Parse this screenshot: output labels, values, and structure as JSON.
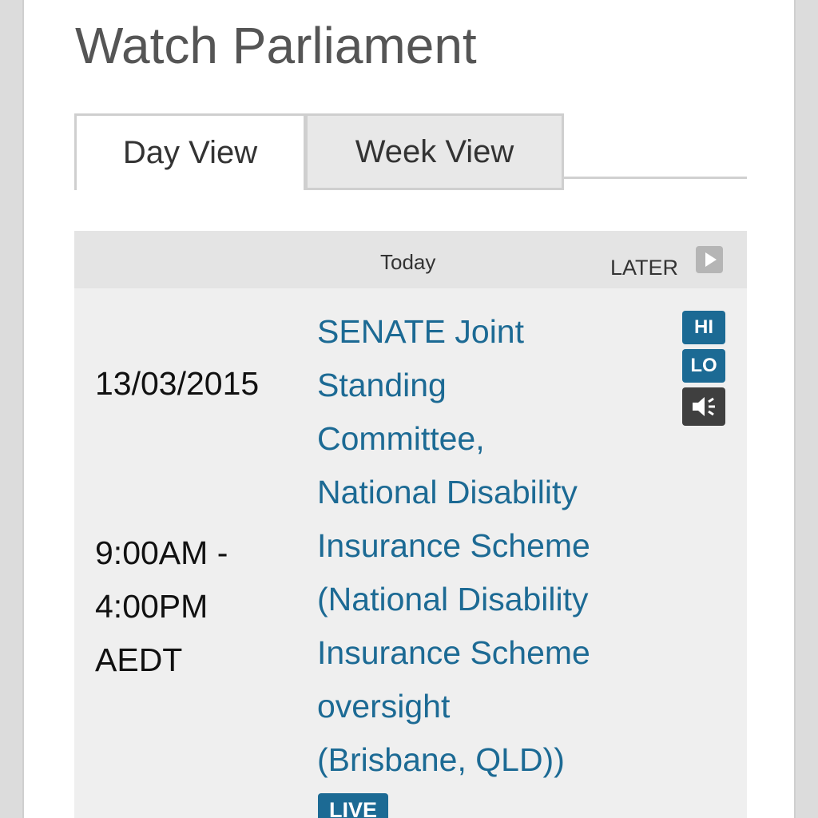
{
  "page": {
    "title": "Watch Parliament"
  },
  "tabs": [
    {
      "label": "Day View",
      "active": true
    },
    {
      "label": "Week View",
      "active": false
    }
  ],
  "schedule": {
    "header": {
      "today_label": "Today",
      "later_label": "LATER",
      "later_icon": "play-arrow-icon"
    },
    "rows": [
      {
        "date": "13/03/2015",
        "time_lines": [
          "9:00AM -",
          "4:00PM",
          "AEDT"
        ],
        "title_lines": [
          "SENATE Joint",
          "Standing",
          "Committee,",
          "National Disability",
          "Insurance Scheme",
          "(National Disability",
          "Insurance Scheme",
          "oversight",
          "(Brisbane, QLD))"
        ],
        "badge": "LIVE",
        "streams": {
          "hi_label": "HI",
          "lo_label": "LO",
          "audio_icon": "speaker-icon"
        }
      }
    ]
  },
  "colors": {
    "link": "#1c6a94",
    "panel_bg": "#efefef",
    "header_bg": "#e4e4e4",
    "audio_btn": "#3f3f3f"
  }
}
